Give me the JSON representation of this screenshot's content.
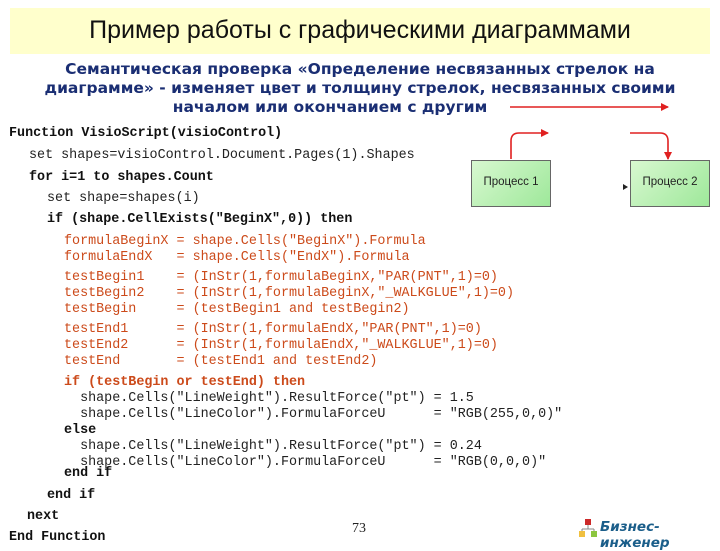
{
  "header": {
    "title": "Пример работы с графическими диаграммами"
  },
  "subtitle": {
    "lines": [
      "Семантическая проверка «Определение несвязанных стрелок на",
      "диаграмме» - изменяет цвет и толщину стрелок, несвязанных своими",
      "началом или окончанием с другим"
    ]
  },
  "diagram": {
    "process1": "Процесс 1",
    "process2": "Процесс 2",
    "arrow_color": "#e02020",
    "box_color": "#a8ec9e"
  },
  "code": {
    "l1": "Function VisioScript(visioControl)",
    "l2": "set shapes=visioControl.Document.Pages(1).Shapes",
    "l3": "for i=1 to shapes.Count",
    "l4": "set shape=shapes(i)",
    "l5": "if (shape.CellExists(\"BeginX\",0)) then",
    "l6": "formulaBeginX = shape.Cells(\"BeginX\").Formula",
    "l7": "formulaEndX   = shape.Cells(\"EndX\").Formula",
    "l8": "testBegin1    = (InStr(1,formulaBeginX,\"PAR(PNT\",1)=0)",
    "l9": "testBegin2    = (InStr(1,formulaBeginX,\"_WALKGLUE\",1)=0)",
    "l10": "testBegin     = (testBegin1 and testBegin2)",
    "l11": "testEnd1      = (InStr(1,formulaEndX,\"PAR(PNT\",1)=0)",
    "l12": "testEnd2      = (InStr(1,formulaEndX,\"_WALKGLUE\",1)=0)",
    "l13": "testEnd       = (testEnd1 and testEnd2)",
    "l14": "if (testBegin or testEnd) then",
    "l15": "  shape.Cells(\"LineWeight\").ResultForce(\"pt\") = 1.5",
    "l16": "  shape.Cells(\"LineColor\").FormulaForceU      = \"RGB(255,0,0)\"",
    "l17": "else",
    "l18": "  shape.Cells(\"LineWeight\").ResultForce(\"pt\") = 0.24",
    "l19": "  shape.Cells(\"LineColor\").FormulaForceU      = \"RGB(0,0,0)\"",
    "l20": "end if",
    "l21": "end if",
    "l22": "next",
    "l23": "End Function"
  },
  "footer": {
    "page_number": "73",
    "logo_text": "Бизнес-инженер"
  }
}
